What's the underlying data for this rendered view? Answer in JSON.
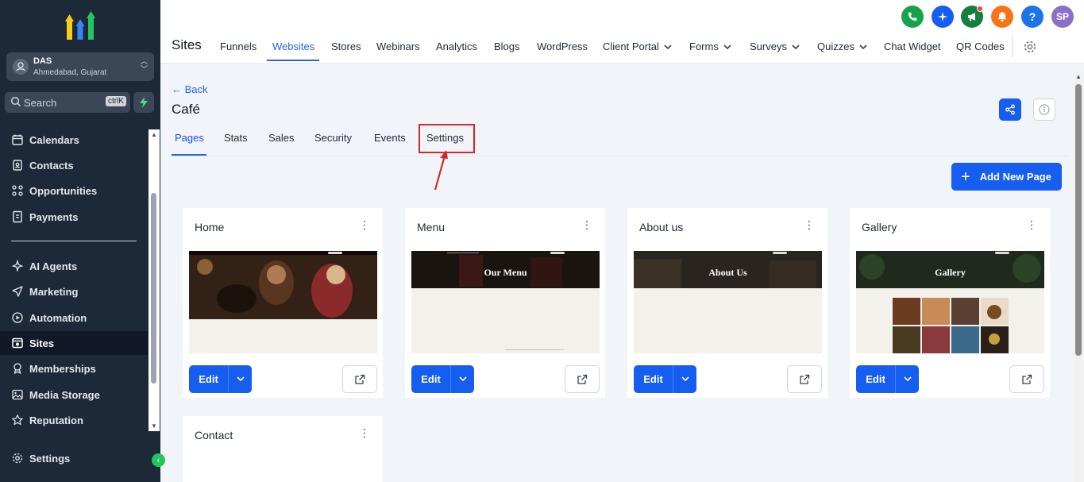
{
  "account": {
    "name": "DAS",
    "location": "Ahmedabad, Gujarat"
  },
  "search": {
    "placeholder": "Search",
    "shortcut": "ctrlK"
  },
  "sidebar": {
    "items": [
      {
        "label": "Calendars",
        "icon": "calendar-icon"
      },
      {
        "label": "Contacts",
        "icon": "contacts-icon"
      },
      {
        "label": "Opportunities",
        "icon": "opportunities-icon"
      },
      {
        "label": "Payments",
        "icon": "payments-icon"
      },
      {
        "label": "AI Agents",
        "icon": "ai-agents-icon"
      },
      {
        "label": "Marketing",
        "icon": "send-icon"
      },
      {
        "label": "Automation",
        "icon": "automation-icon"
      },
      {
        "label": "Sites",
        "icon": "sites-icon",
        "active": true
      },
      {
        "label": "Memberships",
        "icon": "memberships-icon"
      },
      {
        "label": "Media Storage",
        "icon": "media-icon"
      },
      {
        "label": "Reputation",
        "icon": "star-icon"
      }
    ],
    "settings_label": "Settings"
  },
  "header": {
    "title": "Sites",
    "avatar_initials": "SP",
    "help_label": "?",
    "nav": [
      {
        "label": "Funnels"
      },
      {
        "label": "Websites",
        "active": true
      },
      {
        "label": "Stores"
      },
      {
        "label": "Webinars"
      },
      {
        "label": "Analytics"
      },
      {
        "label": "Blogs"
      },
      {
        "label": "WordPress"
      },
      {
        "label": "Client Portal",
        "dropdown": true
      },
      {
        "label": "Forms",
        "dropdown": true
      },
      {
        "label": "Surveys",
        "dropdown": true
      },
      {
        "label": "Quizzes",
        "dropdown": true
      },
      {
        "label": "Chat Widget"
      },
      {
        "label": "QR Codes"
      }
    ],
    "colors": {
      "phone": "#16a34a",
      "sparkle": "#155eef",
      "megaphone": "#15803d",
      "bell": "#f97316",
      "help": "#1d74e8",
      "avatar": "#8b6fc6"
    }
  },
  "main": {
    "back_label": "← Back",
    "site_name": "Café",
    "tabs": [
      {
        "label": "Pages",
        "active": true
      },
      {
        "label": "Stats"
      },
      {
        "label": "Sales"
      },
      {
        "label": "Security"
      },
      {
        "label": "Events"
      },
      {
        "label": "Settings",
        "highlighted": true
      }
    ],
    "add_page_label": "Add New Page",
    "edit_label": "Edit",
    "pages": [
      {
        "title": "Home",
        "hero_text": ""
      },
      {
        "title": "Menu",
        "hero_text": "Our Menu"
      },
      {
        "title": "About us",
        "hero_text": "About Us"
      },
      {
        "title": "Gallery",
        "hero_text": "Gallery"
      },
      {
        "title": "Contact",
        "hero_text": ""
      }
    ]
  },
  "accent_color": "#155eef",
  "annotation_color": "#dc2626"
}
